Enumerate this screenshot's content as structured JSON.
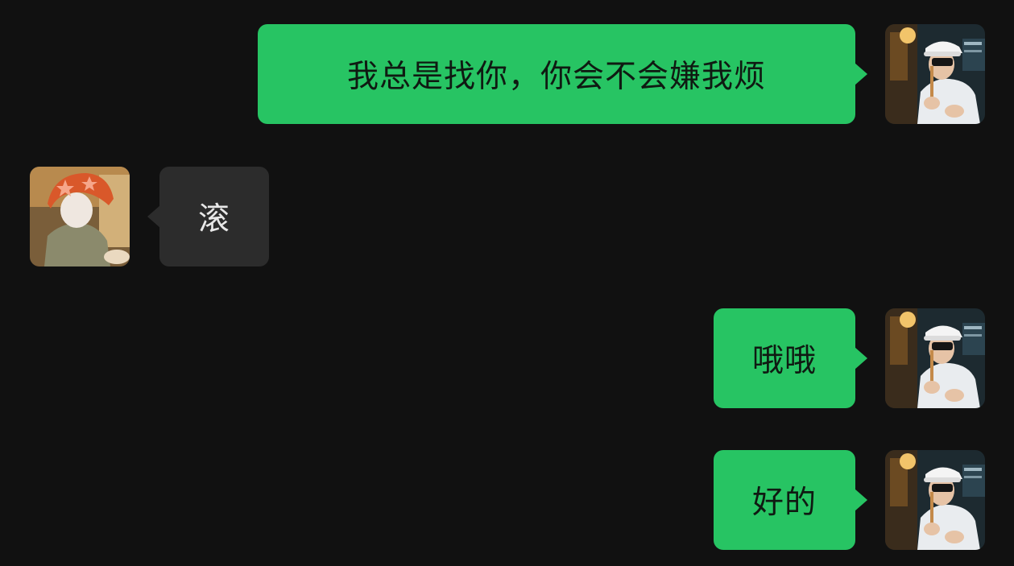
{
  "chat": {
    "messages": [
      {
        "side": "right",
        "sender": "me",
        "text": "我总是找你，你会不会嫌我烦"
      },
      {
        "side": "left",
        "sender": "other",
        "text": "滚"
      },
      {
        "side": "right",
        "sender": "me",
        "text": "哦哦"
      },
      {
        "side": "right",
        "sender": "me",
        "text": "好的"
      }
    ]
  },
  "colors": {
    "background": "#111111",
    "outgoing_bubble": "#27c463",
    "incoming_bubble": "#2c2c2c",
    "incoming_text": "#e8e8e8"
  },
  "avatars": {
    "me": "photo-avatar-boy-white-cap",
    "other": "photo-avatar-orange-star-hat"
  }
}
